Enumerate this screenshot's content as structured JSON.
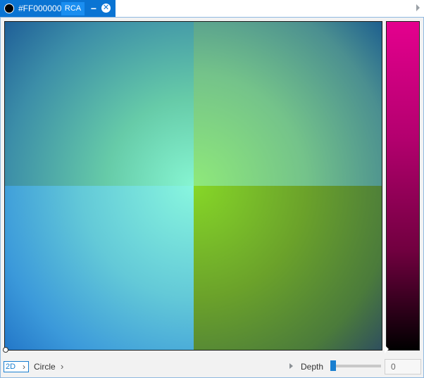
{
  "window": {
    "color_hex": "#FF000000",
    "mode_badge": "RCA",
    "minimize_glyph": "−",
    "close_glyph": "✕",
    "swatch_color": "#000000",
    "accent_color": "#0a74d3"
  },
  "picker": {
    "strip_top_color": "#e4008e",
    "strip_bottom_color": "#000000"
  },
  "bottom": {
    "mode_label": "2D",
    "mode_chevron": "›",
    "shape_label": "Circle",
    "shape_chevron": "›",
    "depth_label": "Depth",
    "depth_value": "0",
    "depth_slider_fraction": 0
  },
  "icons": {
    "titlebar_scroll": "chevron-right-icon",
    "depth_expand": "triangle-right-icon"
  }
}
